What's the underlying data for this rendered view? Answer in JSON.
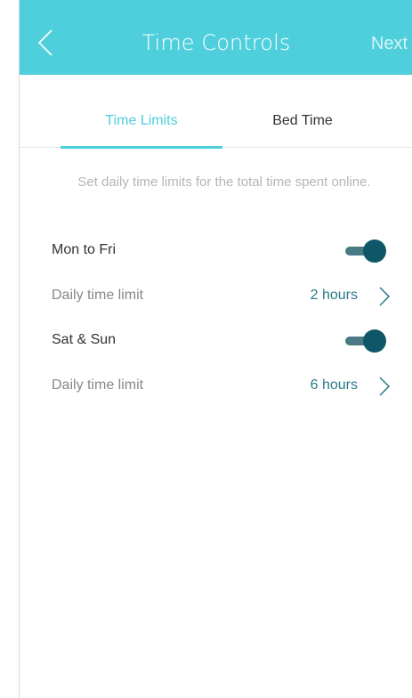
{
  "header": {
    "title": "Time Controls",
    "next_label": "Next",
    "background_color": "#4fcfdc",
    "back_icon": "chevron-left-icon"
  },
  "tabs": [
    {
      "label": "Time Limits",
      "active": true
    },
    {
      "label": "Bed Time",
      "active": false
    }
  ],
  "description": "Set daily time limits for the total time spent online.",
  "schedules": [
    {
      "label": "Mon to Fri",
      "enabled": true,
      "limit_label": "Daily time limit",
      "limit_value": "2 hours"
    },
    {
      "label": "Sat & Sun",
      "enabled": true,
      "limit_label": "Daily time limit",
      "limit_value": "6 hours"
    }
  ],
  "colors": {
    "accent": "#4fcfdc",
    "value_text": "#2a7a88",
    "toggle_on": "#0f5766"
  }
}
